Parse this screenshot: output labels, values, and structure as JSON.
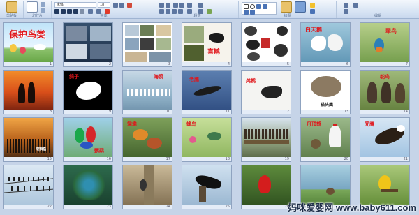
{
  "ribbon": {
    "groups": [
      "剪贴板",
      "幻灯片",
      "字体",
      "段落",
      "绘图",
      "编辑"
    ],
    "font_box": "宋体",
    "size_box": "18"
  },
  "slides": [
    {
      "num": "1",
      "title": "保护鸟类"
    },
    {
      "num": "2",
      "title": ""
    },
    {
      "num": "3",
      "title": ""
    },
    {
      "num": "4",
      "title": "喜鹊"
    },
    {
      "num": "5",
      "title": ""
    },
    {
      "num": "6",
      "title": "白天鹅"
    },
    {
      "num": "7",
      "title": "翠鸟"
    },
    {
      "num": "8",
      "title": ""
    },
    {
      "num": "9",
      "title": "鸽子"
    },
    {
      "num": "10",
      "title": "海鸥"
    },
    {
      "num": "11",
      "title": "老鹰"
    },
    {
      "num": "12",
      "title": "鸬鹚"
    },
    {
      "num": "13",
      "title": "猫头鹰"
    },
    {
      "num": "14",
      "title": "鸵鸟"
    },
    {
      "num": "15",
      "title": "野鸭"
    },
    {
      "num": "16",
      "title": "鹦鹉"
    },
    {
      "num": "17",
      "title": "鸳鸯"
    },
    {
      "num": "18",
      "title": "蜂鸟"
    },
    {
      "num": "19",
      "title": ""
    },
    {
      "num": "20",
      "title": "丹顶鹤"
    },
    {
      "num": "21",
      "title": "秃鹰"
    },
    {
      "num": "22",
      "title": ""
    },
    {
      "num": "23",
      "title": ""
    },
    {
      "num": "24",
      "title": ""
    },
    {
      "num": "25",
      "title": ""
    },
    {
      "num": "26",
      "title": ""
    },
    {
      "num": "27",
      "title": ""
    },
    {
      "num": "28",
      "title": ""
    }
  ],
  "watermark": "妈咪爱婴网 www.baby611.com",
  "colors": {
    "sorter_bg": "#c6d4e8",
    "title_red": "#e0161b"
  }
}
